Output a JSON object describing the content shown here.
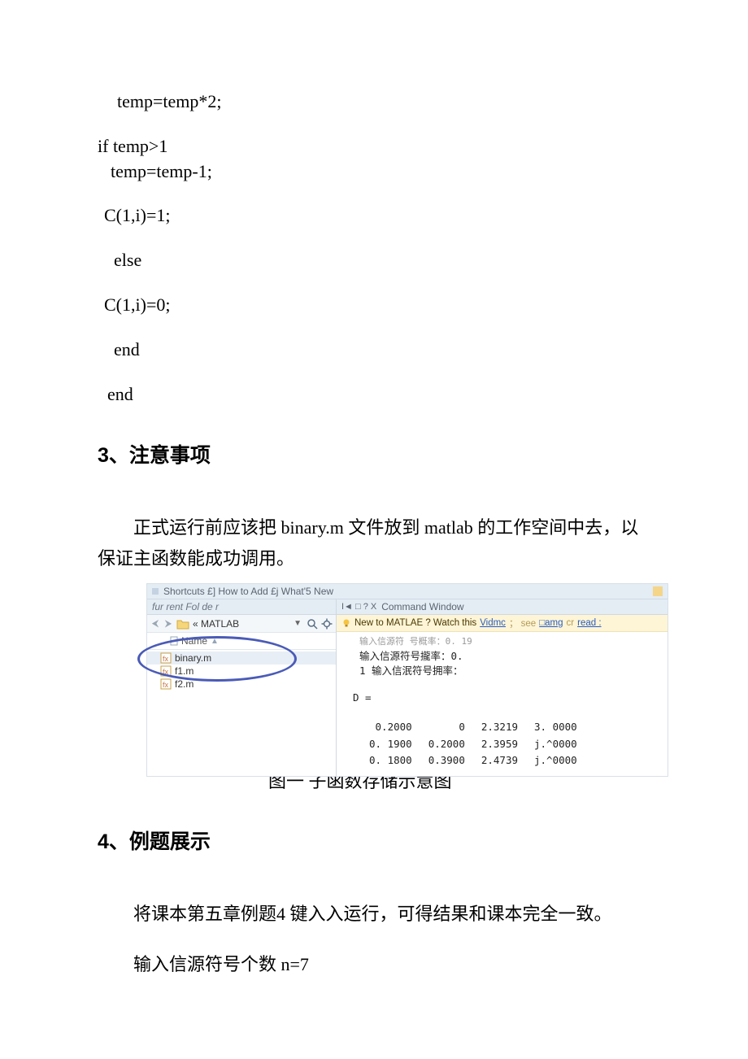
{
  "code_lines": [
    {
      "text": "temp=temp*2;",
      "indent": 24
    },
    {
      "text": "if temp>1",
      "indent": 0
    },
    {
      "text": "temp=temp-1;",
      "indent": 16
    },
    {
      "text": "C(1,i)=1;",
      "indent": 8
    },
    {
      "text": "else",
      "indent": 20
    },
    {
      "text": "C(1,i)=0;",
      "indent": 8
    },
    {
      "text": "end",
      "indent": 20
    },
    {
      "text": "end",
      "indent": 12
    }
  ],
  "heading_3": "3、注意事项",
  "para_3": "正式运行前应该把 binary.m 文件放到 matlab 的工作空间中去，以保证主函数能成功调用。",
  "matlab": {
    "shortcuts_label": "Shortcuts £] How to Add £j What'5 New",
    "left_title": "fur rent Fol de r",
    "path": "« MATLAB",
    "name_header": "Name",
    "files": [
      "binary.m",
      "f1.m",
      "f2.m"
    ],
    "cmd_title": "Command Window",
    "cmd_glyphs": "I◄    □ ? X",
    "banner_prefix": "New to MATLAE ? Watch this",
    "banner_link1": "Vidmc",
    "banner_mid": "；  see ",
    "banner_link2": "□amg",
    "banner_or": " cr ",
    "banner_link3": "read :",
    "cmd_line0": "输入信源符 号概率：0. 19",
    "cmd_line1": "输入信源符号攏率：0.",
    "cmd_line2": "1 输入信泯符号拥率：",
    "d_label": "D  =",
    "chart_data": {
      "type": "table",
      "rows": [
        [
          "0.2000",
          "0",
          "2.3219",
          "3. 0000"
        ],
        [
          "0. 1900",
          "0.2000",
          "2.3959",
          "j.^0000"
        ],
        [
          "0. 1800",
          "0.3900",
          "2.4739",
          "j.^0000"
        ]
      ]
    }
  },
  "figure_caption": "图一  子函数存储示意图",
  "heading_4": "4、例题展示",
  "para_4a": "将课本第五章例题4 键入入运行，可得结果和课本完全一致。",
  "para_4b": "输入信源符号个数 n=7"
}
